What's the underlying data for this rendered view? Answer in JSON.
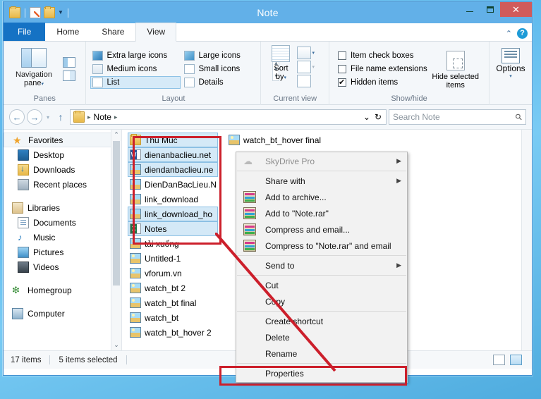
{
  "window": {
    "title": "Note"
  },
  "titlebar": {
    "quick_access": [
      {
        "name": "folder-icon",
        "label": "Folder"
      },
      {
        "name": "properties-icon",
        "label": "Properties"
      },
      {
        "name": "new-folder-icon",
        "label": "New folder"
      },
      {
        "name": "customize-caret",
        "label": "▼"
      }
    ],
    "buttons": {
      "minimize": "",
      "maximize": "",
      "close": "✕"
    }
  },
  "tabs": [
    {
      "label": "File",
      "id": "file"
    },
    {
      "label": "Home",
      "id": "home"
    },
    {
      "label": "Share",
      "id": "share"
    },
    {
      "label": "View",
      "id": "view",
      "active": true
    }
  ],
  "tab_right": {
    "collapse": "⌃",
    "help": "?"
  },
  "ribbon": {
    "groups": [
      {
        "label": "Panes",
        "navigation_pane": "Navigation\npane",
        "navigation_pane_line1": "Navigation",
        "navigation_pane_line2": "pane",
        "preview_pane": "Preview pane",
        "details_pane": "Details pane"
      },
      {
        "label": "Layout",
        "items": [
          {
            "label": "Extra large icons",
            "selected": false
          },
          {
            "label": "Large icons",
            "selected": false
          },
          {
            "label": "Medium icons",
            "selected": false
          },
          {
            "label": "Small icons",
            "selected": false
          },
          {
            "label": "List",
            "selected": true
          },
          {
            "label": "Details",
            "selected": false
          }
        ]
      },
      {
        "label": "Current view",
        "sort_by_line1": "Sort",
        "sort_by_line2": "by"
      },
      {
        "label": "Show/hide",
        "checkboxes": [
          {
            "label": "Item check boxes",
            "checked": false
          },
          {
            "label": "File name extensions",
            "checked": false
          },
          {
            "label": "Hidden items",
            "checked": true
          }
        ],
        "hide_selected_line1": "Hide selected",
        "hide_selected_line2": "items"
      },
      {
        "label": "",
        "options_label": "Options"
      }
    ]
  },
  "addressbar": {
    "back": "←",
    "forward": "→",
    "history": "▼",
    "up": "↑",
    "crumbs": [
      "Note"
    ],
    "dropdown": "⌄",
    "refresh": "↻",
    "search_placeholder": "Search Note"
  },
  "navpane": {
    "sections": [
      {
        "label": "Favorites",
        "icon": "star-icon",
        "root": true,
        "selected": true
      },
      {
        "label": "Desktop",
        "icon": "desktop-icon"
      },
      {
        "label": "Downloads",
        "icon": "downloads-icon"
      },
      {
        "label": "Recent places",
        "icon": "recent-places-icon"
      },
      {
        "spacer": true
      },
      {
        "label": "Libraries",
        "icon": "libraries-icon",
        "root": true
      },
      {
        "label": "Documents",
        "icon": "documents-icon"
      },
      {
        "label": "Music",
        "icon": "music-icon"
      },
      {
        "label": "Pictures",
        "icon": "pictures-icon"
      },
      {
        "label": "Videos",
        "icon": "videos-icon"
      },
      {
        "spacer": true
      },
      {
        "label": "Homegroup",
        "icon": "homegroup-icon",
        "root": true
      },
      {
        "spacer": true
      },
      {
        "label": "Computer",
        "icon": "computer-icon",
        "root": true
      }
    ],
    "scroll_up": "⌃",
    "scroll_down": "⌄"
  },
  "filelist": {
    "column1": [
      {
        "label": "Thu Muc",
        "icon": "folder-icon",
        "selected": true
      },
      {
        "label": "dienanbaclieu.net",
        "icon": "word-icon",
        "selected": true
      },
      {
        "label": "diendanbaclieu.ne",
        "icon": "image-icon",
        "selected": true
      },
      {
        "label": "DienDanBacLieu.N",
        "icon": "image-icon",
        "selected": false
      },
      {
        "label": "link_download",
        "icon": "image-icon",
        "selected": false
      },
      {
        "label": "link_download_ho",
        "icon": "image-icon",
        "selected": true
      },
      {
        "label": "Notes",
        "icon": "excel-icon",
        "selected": true
      },
      {
        "label": "tải xuống",
        "icon": "image-icon",
        "selected": false
      },
      {
        "label": "Untitled-1",
        "icon": "image-icon",
        "selected": false
      },
      {
        "label": "vforum.vn",
        "icon": "image-icon",
        "selected": false
      },
      {
        "label": "watch_bt 2",
        "icon": "image-icon",
        "selected": false
      },
      {
        "label": "watch_bt final",
        "icon": "image-icon",
        "selected": false
      },
      {
        "label": "watch_bt",
        "icon": "image-icon",
        "selected": false
      },
      {
        "label": "watch_bt_hover 2",
        "icon": "image-icon",
        "selected": false
      }
    ],
    "column2": [
      {
        "label": "watch_bt_hover final",
        "icon": "image-icon",
        "selected": false
      }
    ]
  },
  "contextmenu": {
    "items": [
      {
        "label": "SkyDrive Pro",
        "icon": "cloud-icon",
        "submenu": true,
        "disabled": true
      },
      {
        "separator": true
      },
      {
        "label": "Share with",
        "icon": "",
        "submenu": true
      },
      {
        "label": "Add to archive...",
        "icon": "rar-icon"
      },
      {
        "label": "Add to \"Note.rar\"",
        "icon": "rar-icon"
      },
      {
        "label": "Compress and email...",
        "icon": "rar-icon"
      },
      {
        "label": "Compress to \"Note.rar\" and email",
        "icon": "rar-icon"
      },
      {
        "separator": true
      },
      {
        "label": "Send to",
        "icon": "",
        "submenu": true
      },
      {
        "separator": true
      },
      {
        "label": "Cut",
        "icon": ""
      },
      {
        "label": "Copy",
        "icon": ""
      },
      {
        "separator": true
      },
      {
        "label": "Create shortcut",
        "icon": ""
      },
      {
        "label": "Delete",
        "icon": ""
      },
      {
        "label": "Rename",
        "icon": ""
      },
      {
        "separator": true
      },
      {
        "label": "Properties",
        "icon": "",
        "highlighted": true
      }
    ],
    "submenu_arrow": "▶"
  },
  "statusbar": {
    "item_count": "17 items",
    "selection": "5 items selected",
    "view_details": "details-view-icon",
    "view_large": "large-icons-view-icon"
  },
  "colors": {
    "accent": "#62b0e8",
    "file_tab": "#1572c4",
    "annotation_red": "#cc1f2b",
    "selection_blue": "#d4e9f7",
    "close_red": "#d05b5b"
  }
}
